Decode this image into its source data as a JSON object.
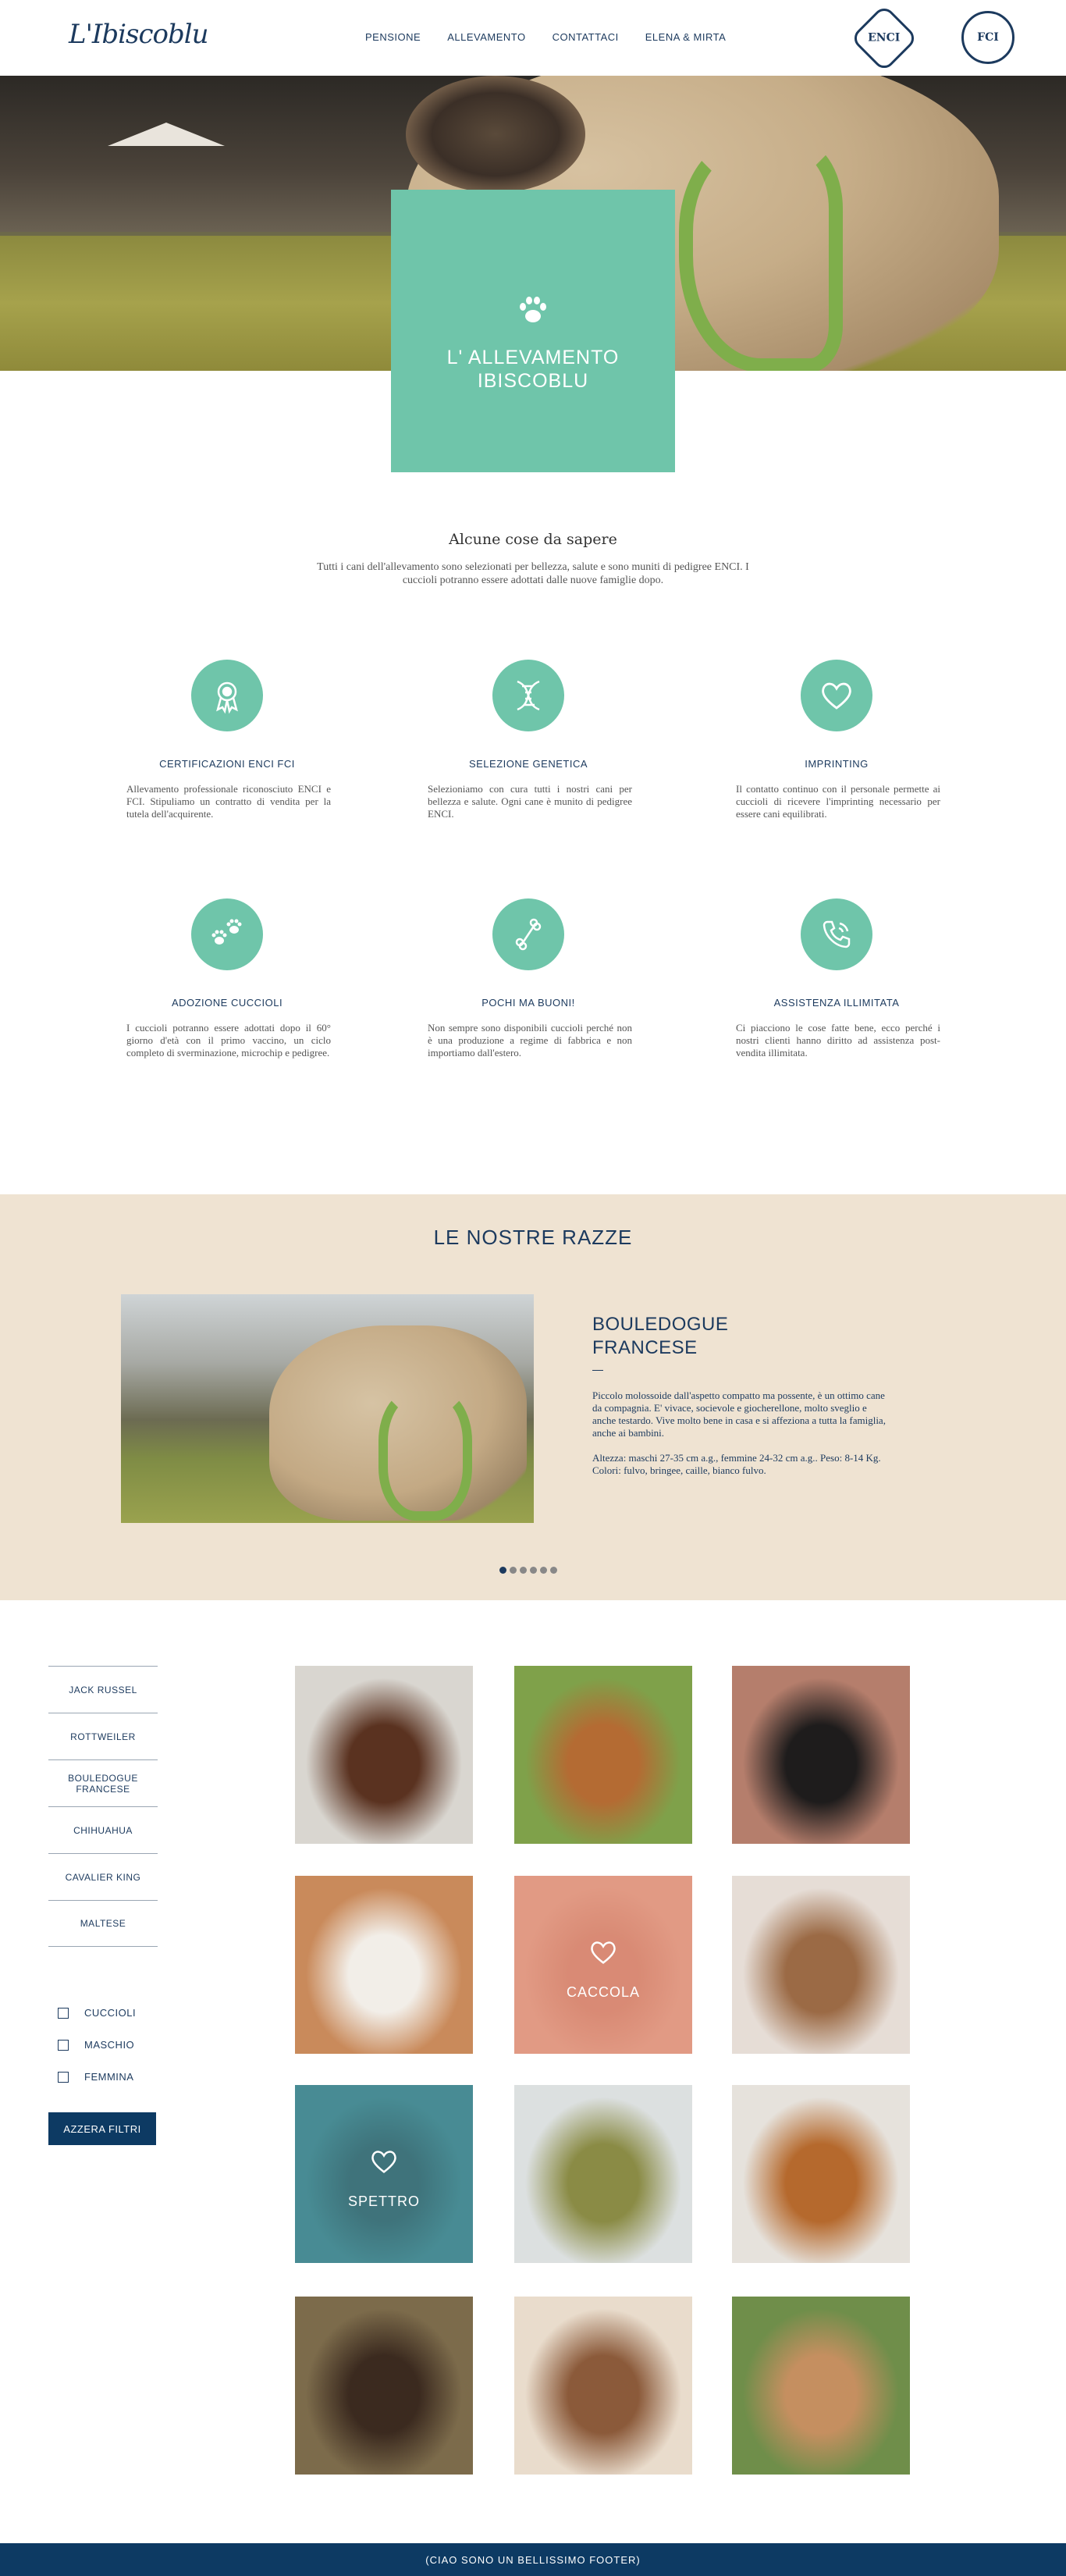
{
  "header": {
    "logo": "L'Ibiscoblu",
    "nav": [
      "PENSIONE",
      "ALLEVAMENTO",
      "CONTATTACI",
      "ELENA & MIRTA"
    ],
    "badges": [
      "ENCI",
      "FCI"
    ]
  },
  "hero": {
    "title": "L' ALLEVAMENTO\nIBISCOBLU"
  },
  "intro": {
    "title": "Alcune cose da sapere",
    "text": "Tutti i cani dell'allevamento sono selezionati per bellezza, salute e sono muniti di pedigree ENCI. I cuccioli potranno essere adottati dalle nuove famiglie dopo."
  },
  "features": [
    {
      "icon": "award-icon",
      "title": "CERTIFICAZIONI ENCI FCI",
      "text": "Allevamento professionale riconosciuto ENCI e FCI. Stipuliamo un contratto di vendita per la tutela dell'acquirente."
    },
    {
      "icon": "dna-icon",
      "title": "SELEZIONE GENETICA",
      "text": "Selezioniamo con cura tutti i nostri cani per bellezza e salute. Ogni cane è munito di pedigree ENCI."
    },
    {
      "icon": "heart-icon",
      "title": "IMPRINTING",
      "text": "Il contatto continuo con il personale permette ai cuccioli di ricevere l'imprinting necessario per essere cani equilibrati."
    },
    {
      "icon": "paws-icon",
      "title": "ADOZIONE CUCCIOLI",
      "text": "I cuccioli potranno essere adottati dopo il 60° giorno d'età con il primo vaccino, un ciclo completo di sverminazione, microchip e pedigree."
    },
    {
      "icon": "bone-icon",
      "title": "POCHI MA BUONI!",
      "text": "Non sempre sono disponibili cuccioli perché non è una produzione a regime di fabbrica e non importiamo dall'estero."
    },
    {
      "icon": "phone-icon",
      "title": "ASSISTENZA ILLIMITATA",
      "text": "Ci piacciono le cose fatte bene, ecco perché i nostri clienti hanno diritto ad assistenza post-vendita illimitata."
    }
  ],
  "breeds": {
    "section_title": "LE NOSTRE RAZZE",
    "name": "BOULEDOGUE\nFRANCESE",
    "paragraph1": "Piccolo molossoide dall'aspetto compatto ma possente, è un ottimo cane da compagnia. E' vivace, socievole e giocherellone, molto sveglio e anche testardo. Vive molto bene in casa e si affeziona a tutta la famiglia, anche ai bambini.",
    "paragraph2": "Altezza: maschi 27-35 cm a.g., femmine 24-32 cm a.g.. Peso: 8-14 Kg. Colori: fulvo, bringee, caille, bianco fulvo.",
    "slides": 6,
    "active_slide": 1
  },
  "filters": {
    "breeds": [
      "JACK RUSSEL",
      "ROTTWEILER",
      "BOULEDOGUE\nFRANCESE",
      "CHIHUAHUA",
      "CAVALIER KING",
      "MALTESE"
    ],
    "checkboxes": [
      "CUCCIOLI",
      "MASCHIO",
      "FEMMINA"
    ],
    "reset_label": "AZZERA FILTRI"
  },
  "dogs": [
    {
      "colors": [
        "#d9d6d0",
        "#5a3220"
      ],
      "overlay": ""
    },
    {
      "colors": [
        "#7fa14a",
        "#b46b33"
      ],
      "overlay": ""
    },
    {
      "colors": [
        "#b57e6c",
        "#1e1c1c"
      ],
      "overlay": ""
    },
    {
      "colors": [
        "#c98a5b",
        "#f2eee8"
      ],
      "overlay": ""
    },
    {
      "colors": [
        "#e1a488",
        "#c46e52"
      ],
      "overlay": "CACCOLA"
    },
    {
      "colors": [
        "#e6ddd6",
        "#9b6a45"
      ],
      "overlay": ""
    },
    {
      "colors": [
        "#4c8a8f",
        "#2b3538"
      ],
      "overlay": "SPETTRO"
    },
    {
      "colors": [
        "#dce0e0",
        "#8a8b45"
      ],
      "overlay": ""
    },
    {
      "colors": [
        "#e6e2dc",
        "#b5692d"
      ],
      "overlay": ""
    },
    {
      "colors": [
        "#7c6b4b",
        "#3b2a1f"
      ],
      "overlay": ""
    },
    {
      "colors": [
        "#e9dccc",
        "#8b5a3a"
      ],
      "overlay": ""
    },
    {
      "colors": [
        "#6f8e4a",
        "#c58f60"
      ],
      "overlay": ""
    }
  ],
  "footer": {
    "text": "(CIAO SONO UN BELLISSIMO FOOTER)"
  },
  "colors": {
    "accent": "#6fc5aa",
    "navy": "#1c3a5e",
    "sand": "#efe3d2",
    "footer": "#0d3a63"
  }
}
